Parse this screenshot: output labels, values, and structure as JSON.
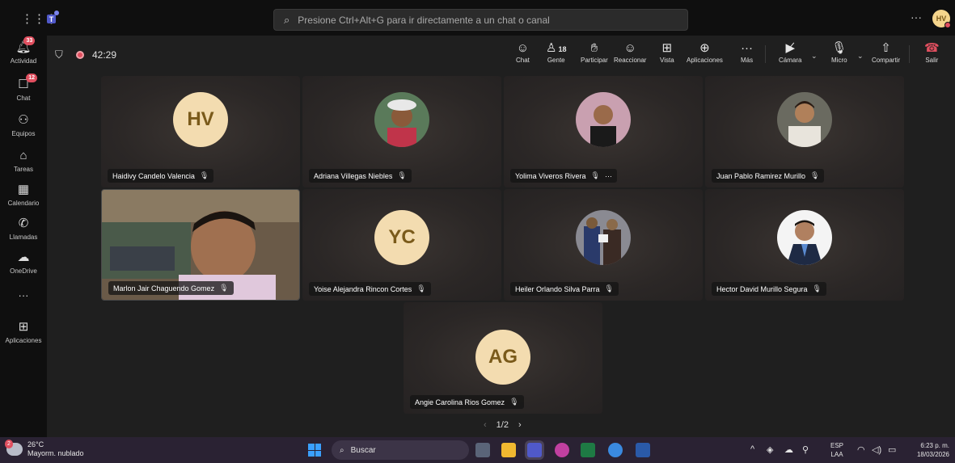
{
  "titlebar": {
    "search_placeholder": "Presione Ctrl+Alt+G para ir directamente a un chat o canal",
    "more": "···",
    "avatar_initials": "HV"
  },
  "rail": {
    "items": [
      {
        "label": "Actividad",
        "icon": "bell-icon",
        "badge": "33"
      },
      {
        "label": "Chat",
        "icon": "chat-icon",
        "badge": "12"
      },
      {
        "label": "Equipos",
        "icon": "teams-icon",
        "badge": ""
      },
      {
        "label": "Tareas",
        "icon": "tasks-icon",
        "badge": ""
      },
      {
        "label": "Calendario",
        "icon": "calendar-icon",
        "badge": ""
      },
      {
        "label": "Llamadas",
        "icon": "phone-icon",
        "badge": ""
      },
      {
        "label": "OneDrive",
        "icon": "cloud-icon",
        "badge": ""
      },
      {
        "label": "···",
        "icon": "more-icon",
        "badge": ""
      },
      {
        "label": "Aplicaciones",
        "icon": "add-apps-icon",
        "badge": ""
      }
    ]
  },
  "meeting": {
    "timer": "42:29",
    "people_count": "18",
    "buttons": {
      "chat": "Chat",
      "people": "Gente",
      "raise": "Participar",
      "react": "Reaccionar",
      "view": "Vista",
      "apps": "Aplicaciones",
      "more": "Más",
      "camera": "Cámara",
      "mic": "Micro",
      "share": "Compartir",
      "leave": "Salir"
    }
  },
  "participants": [
    {
      "name": "Haidivy Candelo Valencia",
      "initials": "HV",
      "kind": "initials"
    },
    {
      "name": "Adriana Villegas Niebles",
      "initials": "",
      "kind": "photo"
    },
    {
      "name": "Yolima Viveros Rivera",
      "initials": "",
      "kind": "photo",
      "extra": "···"
    },
    {
      "name": "Juan Pablo Ramirez Murillo",
      "initials": "",
      "kind": "photo"
    },
    {
      "name": "Marlon Jair Chaguendo Gomez",
      "initials": "",
      "kind": "video"
    },
    {
      "name": "Yoise Alejandra Rincon Cortes",
      "initials": "YC",
      "kind": "initials"
    },
    {
      "name": "Heiler Orlando Silva Parra",
      "initials": "",
      "kind": "photo"
    },
    {
      "name": "Hector David Murillo Segura",
      "initials": "",
      "kind": "photo"
    },
    {
      "name": "Angie Carolina Rios Gomez",
      "initials": "AG",
      "kind": "initials"
    }
  ],
  "pager": {
    "prev": "‹",
    "label": "1/2",
    "next": "›"
  },
  "taskbar": {
    "weather_badge": "2",
    "temperature": "26°C",
    "condition": "Mayorm. nublado",
    "search_label": "Buscar",
    "lang_top": "ESP",
    "lang_bottom": "LAA",
    "time": "6:23 p. m.",
    "date": "18/03/2026"
  }
}
